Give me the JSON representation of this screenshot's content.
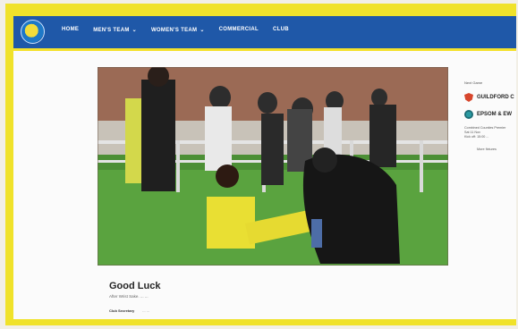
{
  "navigation": {
    "items": [
      {
        "label": "HOME",
        "has_dropdown": false
      },
      {
        "label": "MEN'S TEAM",
        "has_dropdown": true
      },
      {
        "label": "WOMEN'S TEAM",
        "has_dropdown": true
      },
      {
        "label": "COMMERCIAL",
        "has_dropdown": false
      },
      {
        "label": "CLUB",
        "has_dropdown": false
      }
    ],
    "dropdown_icon": "chevron-down-icon"
  },
  "article": {
    "title": "Good Luck",
    "subtitle": "After Wrist Sake. ... ...",
    "author": "Club Secretary",
    "date": "... ..."
  },
  "sidebar": {
    "heading": "Next Game",
    "teams": [
      {
        "name": "GUILDFORD C",
        "badge_icon": "guildford-crest-icon",
        "color": "#d7462c"
      },
      {
        "name": "EPSOM & EW",
        "badge_icon": "epsom-crest-icon",
        "color": "#2a9aa1"
      }
    ],
    "fixture_lines": [
      "Combined Counties Premier",
      "Sat 11 Nov",
      "Kick off: 15:00 ..."
    ],
    "link": "More fixtures"
  },
  "colors": {
    "frame": "#f0e22a",
    "navbar": "#1f58a8",
    "accent_kit": "#e9df33"
  }
}
